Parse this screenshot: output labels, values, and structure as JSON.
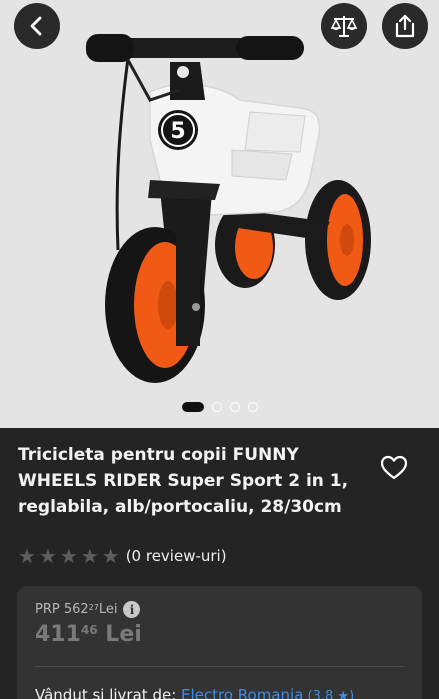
{
  "product": {
    "title": "Tricicleta pentru copii FUNNY WHEELS RIDER Super Sport 2 in 1, reglabila, alb/portocaliu, 28/30cm",
    "bike_number": "5"
  },
  "gallery": {
    "image_count": 4,
    "active_index": 0
  },
  "rating": {
    "stars_total": 5,
    "stars_filled": 0,
    "review_text": "(0 review-uri)"
  },
  "price": {
    "prp_label": "PRP 562",
    "prp_decimals": "27",
    "prp_currency": " Lei",
    "current_whole": "411",
    "current_decimals": "46",
    "current_currency": " Lei"
  },
  "seller": {
    "label": "Vândut și livrat de: ",
    "name": "Electro Romania",
    "rating": " (3,8 ★)"
  },
  "colors": {
    "background": "#242424",
    "card": "#333333",
    "link": "#3d8ee8",
    "wheel_rim": "#f05a14",
    "image_bg": "#e4e4e4"
  },
  "icons": [
    "back-arrow-icon",
    "scale-compare-icon",
    "share-icon",
    "heart-icon",
    "star-icon",
    "info-icon"
  ]
}
